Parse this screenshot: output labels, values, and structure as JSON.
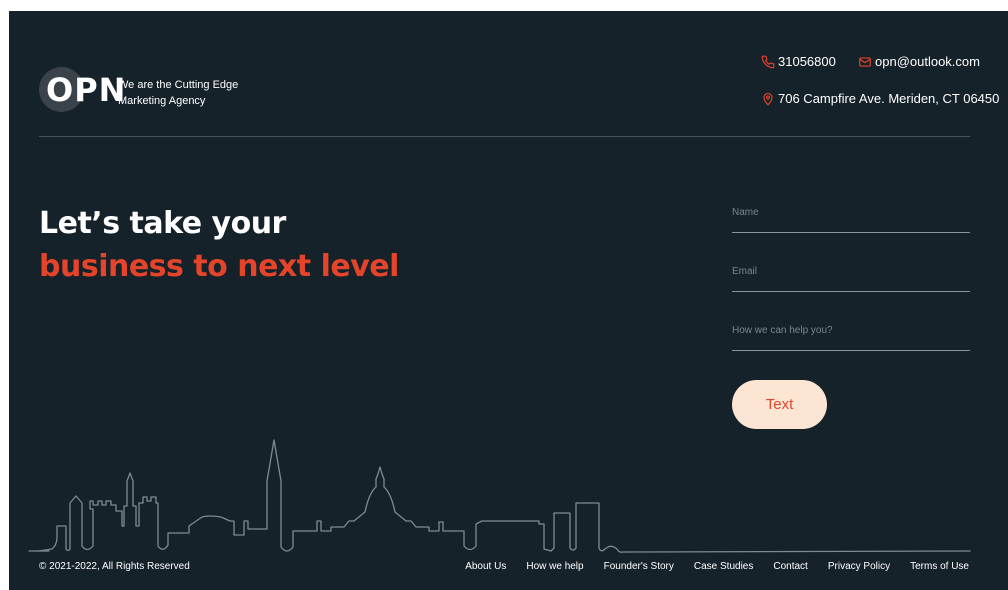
{
  "brand": {
    "logo_text": "OPN",
    "tagline": "We are the Cutting Edge Marketing Agency"
  },
  "contact": {
    "phone": "31056800",
    "email": "opn@outlook.com",
    "address": "706 Campfire Ave. Meriden, CT 06450",
    "phone_icon": "phone-icon",
    "email_icon": "mail-icon",
    "address_icon": "location-pin-icon"
  },
  "hero": {
    "line1": "Let’s take your",
    "line2": "business to next level"
  },
  "form": {
    "name_placeholder": "Name",
    "email_placeholder": "Email",
    "help_placeholder": "How we can help you?",
    "submit_label": "Text"
  },
  "footer": {
    "copyright": "© 2021-2022, All Rights Reserved",
    "links": [
      "About Us",
      "How we help",
      "Founder's Story",
      "Case Studies",
      "Contact",
      "Privacy Policy",
      "Terms of Use"
    ]
  },
  "colors": {
    "background": "#16222a",
    "accent": "#e4442a",
    "button_bg": "#fde5d3",
    "skyline_stroke": "#7f8a90"
  }
}
